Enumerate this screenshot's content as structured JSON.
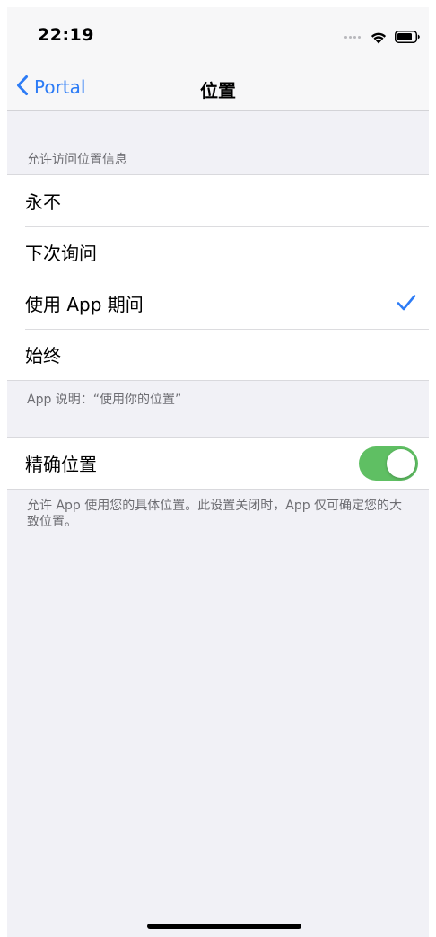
{
  "status_bar": {
    "time": "22:19",
    "icons": [
      "signal-dots-icon",
      "wifi-icon",
      "battery-icon"
    ]
  },
  "nav": {
    "back_label": "Portal",
    "back_icon": "chevron-left-icon",
    "title": "位置"
  },
  "access_section": {
    "header": "允许访问位置信息",
    "options": [
      {
        "label": "永不",
        "selected": false
      },
      {
        "label": "下次询问",
        "selected": false
      },
      {
        "label": "使用 App 期间",
        "selected": true
      },
      {
        "label": "始终",
        "selected": false
      }
    ],
    "footer": "App 说明：“使用你的位置”"
  },
  "precise_section": {
    "label": "精确位置",
    "toggle_on": true,
    "footer": "允许 App 使用您的具体位置。此设置关闭时，App 仅可确定您的大致位置。"
  },
  "colors": {
    "accent": "#2d7cf6",
    "toggle_on": "#5fbf63",
    "background": "#f1f1f6"
  }
}
